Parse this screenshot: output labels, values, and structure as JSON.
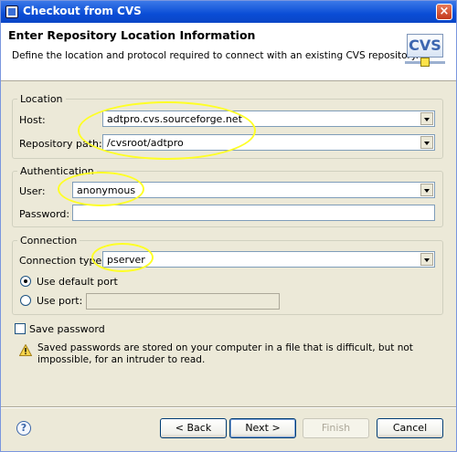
{
  "window": {
    "title": "Checkout from CVS",
    "close_label": "×"
  },
  "header": {
    "title": "Enter Repository Location Information",
    "description": "Define the location and protocol required to connect with an existing CVS repository.",
    "logo_text": "CVS"
  },
  "location": {
    "legend": "Location",
    "host_label": "Host:",
    "host_value": "adtpro.cvs.sourceforge.net",
    "repo_label": "Repository path:",
    "repo_value": "/cvsroot/adtpro"
  },
  "authentication": {
    "legend": "Authentication",
    "user_label": "User:",
    "user_value": "anonymous",
    "password_label": "Password:",
    "password_value": ""
  },
  "connection": {
    "legend": "Connection",
    "type_label": "Connection type:",
    "type_value": "pserver",
    "default_port_label": "Use default port",
    "use_port_label": "Use port:",
    "port_value": ""
  },
  "save_password": {
    "label": "Save password",
    "checked": false,
    "warning": "Saved passwords are stored on your computer in a file that is difficult, but not impossible, for an intruder to read."
  },
  "footer": {
    "help": "?",
    "back": "< Back",
    "next": "Next >",
    "finish": "Finish",
    "cancel": "Cancel"
  },
  "colors": {
    "highlight": "#ffff26",
    "titlebar": "#0a4dd6"
  }
}
